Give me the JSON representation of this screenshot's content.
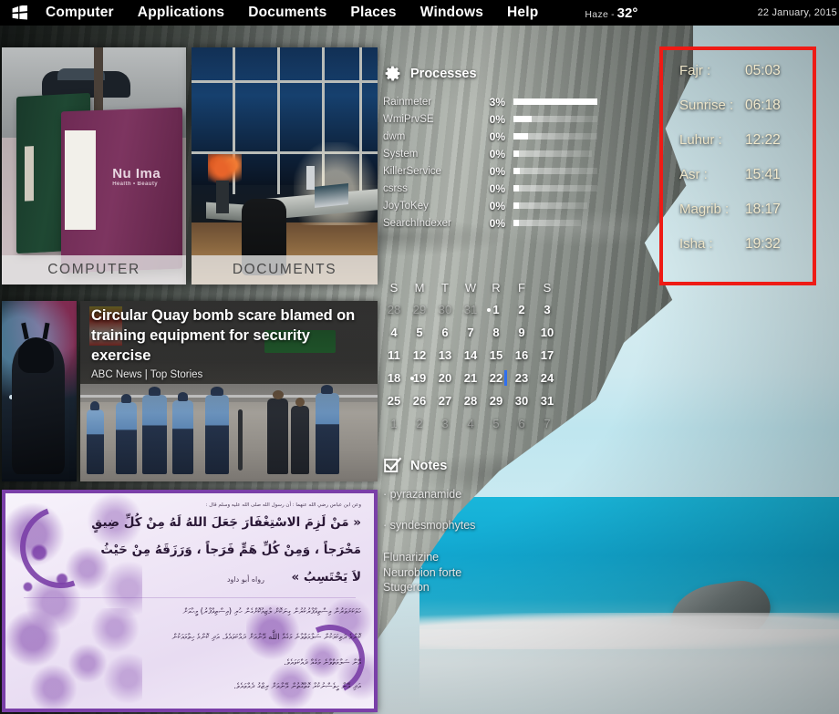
{
  "menubar": {
    "logo_icon": "windows-logo-icon",
    "items": [
      "Computer",
      "Applications",
      "Documents",
      "Places",
      "Windows",
      "Help"
    ],
    "weather": {
      "condition": "Haze",
      "separator": "-",
      "temperature": "32°"
    },
    "date": "22 January, 2015"
  },
  "tiles": [
    {
      "label": "COMPUTER",
      "image": "newspaper-boxes-photo"
    },
    {
      "label": "DOCUMENTS",
      "image": "night-office-desk-photo"
    }
  ],
  "news": {
    "hero_image": "batman-figure-photo",
    "headline": "Circular Quay bomb scare blamed on training equipment for security exercise",
    "source": "ABC News | Top Stories"
  },
  "processes": {
    "title": "Processes",
    "icon": "gear-icon",
    "rows": [
      {
        "name": "Rainmeter",
        "percent": "3%",
        "fill": 100,
        "trail": 100
      },
      {
        "name": "WmiPrvSE",
        "percent": "0%",
        "fill": 22,
        "trail": 100
      },
      {
        "name": "dwm",
        "percent": "0%",
        "fill": 17,
        "trail": 100
      },
      {
        "name": "System",
        "percent": "0%",
        "fill": 7,
        "trail": 94
      },
      {
        "name": "KillerService",
        "percent": "0%",
        "fill": 8,
        "trail": 100
      },
      {
        "name": "csrss",
        "percent": "0%",
        "fill": 6,
        "trail": 100
      },
      {
        "name": "JoyToKey",
        "percent": "0%",
        "fill": 6,
        "trail": 88
      },
      {
        "name": "SearchIndexer",
        "percent": "0%",
        "fill": 6,
        "trail": 80
      }
    ]
  },
  "calendar": {
    "weekdays": [
      "S",
      "M",
      "T",
      "W",
      "R",
      "F",
      "S"
    ],
    "weeks": [
      [
        {
          "d": "28",
          "out": true
        },
        {
          "d": "29",
          "out": true
        },
        {
          "d": "30",
          "out": true
        },
        {
          "d": "31",
          "out": true
        },
        {
          "d": "1",
          "dot": true
        },
        {
          "d": "2"
        },
        {
          "d": "3"
        }
      ],
      [
        {
          "d": "4"
        },
        {
          "d": "5"
        },
        {
          "d": "6"
        },
        {
          "d": "7"
        },
        {
          "d": "8"
        },
        {
          "d": "9"
        },
        {
          "d": "10"
        }
      ],
      [
        {
          "d": "11"
        },
        {
          "d": "12"
        },
        {
          "d": "13"
        },
        {
          "d": "14"
        },
        {
          "d": "15"
        },
        {
          "d": "16"
        },
        {
          "d": "17"
        }
      ],
      [
        {
          "d": "18"
        },
        {
          "d": "19",
          "dot": true
        },
        {
          "d": "20"
        },
        {
          "d": "21"
        },
        {
          "d": "22",
          "today": true
        },
        {
          "d": "23"
        },
        {
          "d": "24"
        }
      ],
      [
        {
          "d": "25"
        },
        {
          "d": "26"
        },
        {
          "d": "27"
        },
        {
          "d": "28"
        },
        {
          "d": "29"
        },
        {
          "d": "30"
        },
        {
          "d": "31"
        }
      ],
      [
        {
          "d": "1",
          "out": true
        },
        {
          "d": "2",
          "out": true
        },
        {
          "d": "3",
          "out": true
        },
        {
          "d": "4",
          "out": true
        },
        {
          "d": "5",
          "out": true
        },
        {
          "d": "6",
          "out": true
        },
        {
          "d": "7",
          "out": true
        }
      ]
    ]
  },
  "notes": {
    "title": "Notes",
    "icon": "checkbox-checked-icon",
    "bullets": [
      "·  pyrazanamide",
      "·   syndesmophytes"
    ],
    "lines": [
      "Flunarizine",
      "Neurobion forte",
      "Stugeron"
    ]
  },
  "prayer": {
    "border_color": "#ee1b15",
    "rows": [
      {
        "name": "Fajr :",
        "time": "05:03"
      },
      {
        "name": "Sunrise :",
        "time": "06:18"
      },
      {
        "name": "Luhur :",
        "time": "12:22"
      },
      {
        "name": "Asr :",
        "time": "15:41"
      },
      {
        "name": "Magrib :",
        "time": "18:17"
      },
      {
        "name": "Isha :",
        "time": "19:32"
      }
    ]
  },
  "hadith": {
    "attribution_top": "وعن ابن عباس رضي الله عنهما : أن رسول الله صلى الله عليه وسلم قال :",
    "text_line1": "« مَنْ لَزِمَ الاسْتِغْفَارَ جَعَلَ اللهُ لَهُ مِنْ كُلِّ ضِيقٍ",
    "text_line2": "مَخْرَجاً ، وَمِنْ كُلِّ هَمٍّ فَرَجاً ، وَرَزَقَهُ مِنْ حَيْثُ",
    "text_line3": "لاَ يَحْتَسِبُ »",
    "narrator": "رواه أبو داود",
    "dhivehi_line1": "ހަމަކަށަވަރުން އިސްތިޣްފާރުކުރުން ގިނަކޮށް ލާޒިމުކޮށްގެން ހުރި (އިސްތިޣްފާރު) މީހާއަށް",
    "dhivehi_line2": "ކޮންމެ ދަތިކަމަކުން ސަލާމަތްވާނެ މަގެއް اللَّه އޭނާއަށް ދައްކަވައެވެ. އަދި ކޮންމެ ހިތާމައަކުން",
    "dhivehi_line3": "އޭނާ ސަލާމަތްވާނެ މަގެއް ދައްކަވައެވެ.",
    "dhivehi_line4": "އަދި އޭނާ ހީވެސްނުކުރާ ގޮތްގޮތުން އޭނާއަށް ރިޒްޤު ދެއްވައެވެ."
  }
}
